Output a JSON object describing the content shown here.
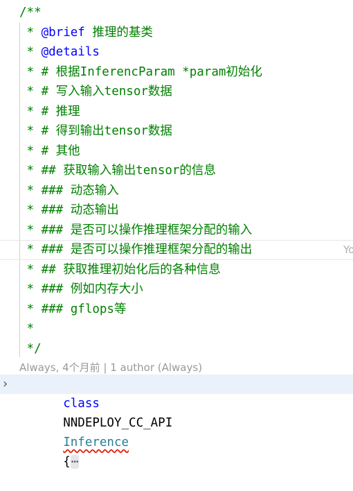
{
  "comment": {
    "lines": [
      {
        "prefix": "/**",
        "tag": "",
        "text": ""
      },
      {
        "prefix": " * ",
        "tag": "@brief",
        "text": " 推理的基类"
      },
      {
        "prefix": " * ",
        "tag": "@details",
        "text": ""
      },
      {
        "prefix": " * ",
        "tag": "",
        "text": "# 根据InferencParam *param初始化"
      },
      {
        "prefix": " * ",
        "tag": "",
        "text": "# 写入输入tensor数据"
      },
      {
        "prefix": " * ",
        "tag": "",
        "text": "# 推理"
      },
      {
        "prefix": " * ",
        "tag": "",
        "text": "# 得到输出tensor数据"
      },
      {
        "prefix": " * ",
        "tag": "",
        "text": "# 其他"
      },
      {
        "prefix": " * ",
        "tag": "",
        "text": "## 获取输入输出tensor的信息"
      },
      {
        "prefix": " * ",
        "tag": "",
        "text": "### 动态输入"
      },
      {
        "prefix": " * ",
        "tag": "",
        "text": "### 动态输出"
      },
      {
        "prefix": " * ",
        "tag": "",
        "text": "### 是否可以操作推理框架分配的输入"
      },
      {
        "prefix": " * ",
        "tag": "",
        "text": "### 是否可以操作推理框架分配的输出"
      },
      {
        "prefix": " * ",
        "tag": "",
        "text": "## 获取推理初始化后的各种信息"
      },
      {
        "prefix": " * ",
        "tag": "",
        "text": "### 例如内存大小"
      },
      {
        "prefix": " * ",
        "tag": "",
        "text": "### gflops等"
      },
      {
        "prefix": " *",
        "tag": "",
        "text": ""
      },
      {
        "prefix": " */",
        "tag": "",
        "text": ""
      }
    ],
    "ghost_text": "Yo"
  },
  "blame": {
    "text": "Always, 4个月前 | 1 author (Always)"
  },
  "code": {
    "keyword": "class",
    "macro": "NNDEPLOY_CC_API",
    "class_name": "Inference",
    "brace": "{",
    "folded": "⋯"
  },
  "icons": {
    "fold": "chevron-right-icon"
  },
  "colors": {
    "comment": "#008000",
    "keyword": "#0000ff",
    "type": "#267f99",
    "error_squiggle": "#e51400",
    "blame": "#999999",
    "current_line_bg": "#eaf1fb"
  }
}
